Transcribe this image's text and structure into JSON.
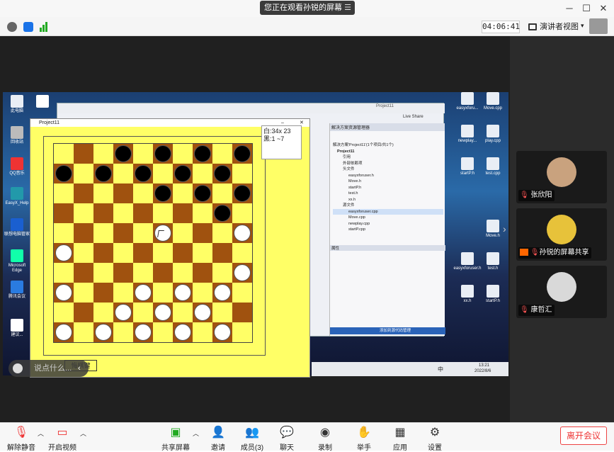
{
  "banner": {
    "text": "您正在观看孙锐的屏幕"
  },
  "header": {
    "timer": "04:06:41",
    "view_label": "演讲者视图"
  },
  "game": {
    "window_title": "Project11",
    "score_line1": "白:34x 23",
    "score_line2": "黑:1  ~7",
    "undo_label": "悔棋键",
    "black_pieces": [
      [
        0,
        3
      ],
      [
        0,
        5
      ],
      [
        0,
        7
      ],
      [
        0,
        9
      ],
      [
        1,
        0
      ],
      [
        1,
        2
      ],
      [
        1,
        4
      ],
      [
        1,
        6
      ],
      [
        1,
        8
      ],
      [
        2,
        5
      ],
      [
        2,
        7
      ],
      [
        2,
        9
      ],
      [
        3,
        8
      ]
    ],
    "white_pieces": [
      [
        4,
        5
      ],
      [
        4,
        9
      ],
      [
        5,
        0
      ],
      [
        6,
        9
      ],
      [
        7,
        0
      ],
      [
        7,
        4
      ],
      [
        7,
        6
      ],
      [
        7,
        8
      ],
      [
        8,
        3
      ],
      [
        8,
        5
      ],
      [
        8,
        7
      ],
      [
        9,
        0
      ],
      [
        9,
        2
      ],
      [
        9,
        4
      ],
      [
        9,
        6
      ],
      [
        9,
        8
      ]
    ]
  },
  "remote_desktop": {
    "icons_left": [
      "此电脑",
      "回收站",
      "QQ音乐",
      "EasyX_Help",
      "联想电脑管家",
      "Microsoft Edge",
      "腾讯会议",
      "建议..."
    ],
    "icons_right": [
      "easyxforu...",
      "Move.cpp",
      "newplay...",
      "play.cpp",
      "startP.h",
      "test.cpp",
      "Move.h",
      "easyxforuser.h",
      "test.h",
      "startP.h",
      "xx.h"
    ],
    "vs_title": "Project11",
    "vs_live_share": "Live Share",
    "vs_solution_header": "解决方案资源管理器",
    "vs_tree": [
      "解决方案'Project11'(1个项目/共1个)",
      "Project11",
      "引用",
      "外部依赖项",
      "头文件",
      "easyxforuser.h",
      "Move.h",
      "startP.h",
      "test.h",
      "xx.h",
      "源文件",
      "easyxforuser.cpp",
      "Move.cpp",
      "newplay.cpp",
      "startP.cpp"
    ],
    "vs_props": "属性",
    "vs_add_source": "添加到源代码管理",
    "taskbar_time": "13:21",
    "taskbar_date": "2022/8/6",
    "taskbar_ime": "中"
  },
  "chat": {
    "placeholder": "说点什么..."
  },
  "participants": [
    {
      "name": "张欣阳",
      "avatar_color": "#c9a27e"
    },
    {
      "name": "孙锐的屏幕共享",
      "avatar_color": "#e7c23a"
    },
    {
      "name": "康哲汇",
      "avatar_color": "#d9d9d9"
    }
  ],
  "toolbar": {
    "unmute": "解除静音",
    "video": "开启视频",
    "share": "共享屏幕",
    "invite": "邀请",
    "members": "成员(3)",
    "chat": "聊天",
    "record": "录制",
    "raise_hand": "举手",
    "apps": "应用",
    "settings": "设置",
    "leave": "离开会议"
  },
  "colors": {
    "board_yellow": "#ffff66",
    "board_brown": "#a0520f",
    "leave_red": "#e33333"
  }
}
